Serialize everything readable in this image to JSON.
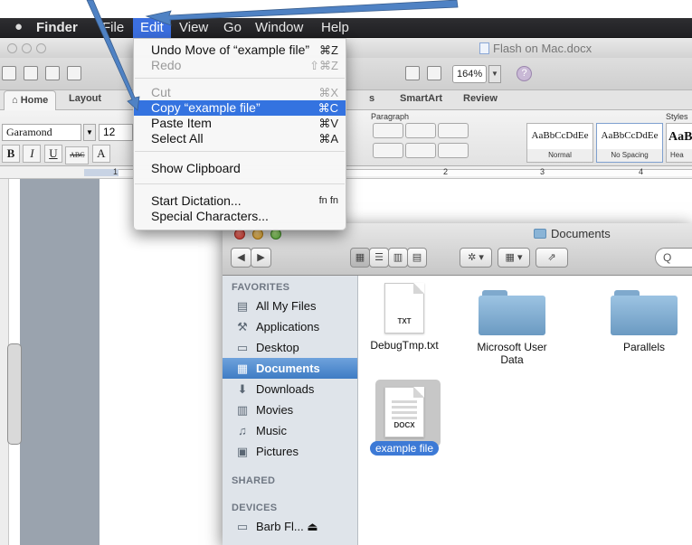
{
  "menubar": {
    "apple": "",
    "items": [
      "Finder",
      "File",
      "Edit",
      "View",
      "Go",
      "Window",
      "Help"
    ]
  },
  "edit_menu": {
    "items": [
      {
        "label": "Undo Move of “example file”",
        "shortcut": "⌘Z",
        "state": "enabled"
      },
      {
        "label": "Redo",
        "shortcut": "⇧⌘Z",
        "state": "disabled"
      },
      {
        "label": "Cut",
        "shortcut": "⌘X",
        "state": "disabled"
      },
      {
        "label": "Copy “example file”",
        "shortcut": "⌘C",
        "state": "highlighted"
      },
      {
        "label": "Paste Item",
        "shortcut": "⌘V",
        "state": "enabled"
      },
      {
        "label": "Select All",
        "shortcut": "⌘A",
        "state": "enabled"
      },
      {
        "label": "Show Clipboard",
        "shortcut": "",
        "state": "enabled"
      },
      {
        "label": "Start Dictation...",
        "shortcut": "fn fn",
        "state": "enabled"
      },
      {
        "label": "Special Characters...",
        "shortcut": "",
        "state": "enabled"
      }
    ]
  },
  "word": {
    "doc_title": "Flash on Mac.docx",
    "zoom": "164%",
    "tabs": [
      "Home",
      "Layout",
      "s",
      "SmartArt",
      "Review"
    ],
    "font_name": "Garamond",
    "font_size": "12",
    "format_buttons": [
      "B",
      "I",
      "U",
      "ABC",
      "A"
    ],
    "paragraph_label": "Paragraph",
    "styles_label": "Styles",
    "styles": [
      {
        "sample": "AaBbCcDdEe",
        "name": "Normal"
      },
      {
        "sample": "AaBbCcDdEe",
        "name": "No Spacing"
      },
      {
        "sample": "AaBl",
        "name": "Hea"
      }
    ],
    "ruler_marks": [
      "1",
      "2",
      "3",
      "4"
    ]
  },
  "finder": {
    "title": "Documents",
    "search_placeholder": "Q",
    "sidebar": {
      "favorites_heading": "FAVORITES",
      "favorites": [
        {
          "label": "All My Files",
          "icon": "all-files-icon",
          "glyph": "▤",
          "selected": false
        },
        {
          "label": "Applications",
          "icon": "applications-icon",
          "glyph": "⚒",
          "selected": false
        },
        {
          "label": "Desktop",
          "icon": "desktop-icon",
          "glyph": "▭",
          "selected": false
        },
        {
          "label": "Documents",
          "icon": "documents-icon",
          "glyph": "▦",
          "selected": true
        },
        {
          "label": "Downloads",
          "icon": "downloads-icon",
          "glyph": "⬇",
          "selected": false
        },
        {
          "label": "Movies",
          "icon": "movies-icon",
          "glyph": "▥",
          "selected": false
        },
        {
          "label": "Music",
          "icon": "music-icon",
          "glyph": "♫",
          "selected": false
        },
        {
          "label": "Pictures",
          "icon": "pictures-icon",
          "glyph": "▣",
          "selected": false
        }
      ],
      "shared_heading": "SHARED",
      "devices_heading": "DEVICES",
      "devices": [
        {
          "label": "Barb Fl...  ⏏",
          "icon": "drive-icon",
          "glyph": "▭"
        }
      ]
    },
    "files": [
      {
        "name": "DebugTmp.txt",
        "kind": "doc",
        "ext": "TXT"
      },
      {
        "name": "Microsoft User Data",
        "kind": "folder",
        "ext": ""
      },
      {
        "name": "Parallels",
        "kind": "folder",
        "ext": ""
      },
      {
        "name": "example file",
        "kind": "doc",
        "ext": "DOCX",
        "selected": true
      }
    ]
  },
  "colors": {
    "menu_highlight": "#3473e0",
    "sidebar_selected": "#3f7cc4",
    "arrow": "#4f82c4"
  }
}
